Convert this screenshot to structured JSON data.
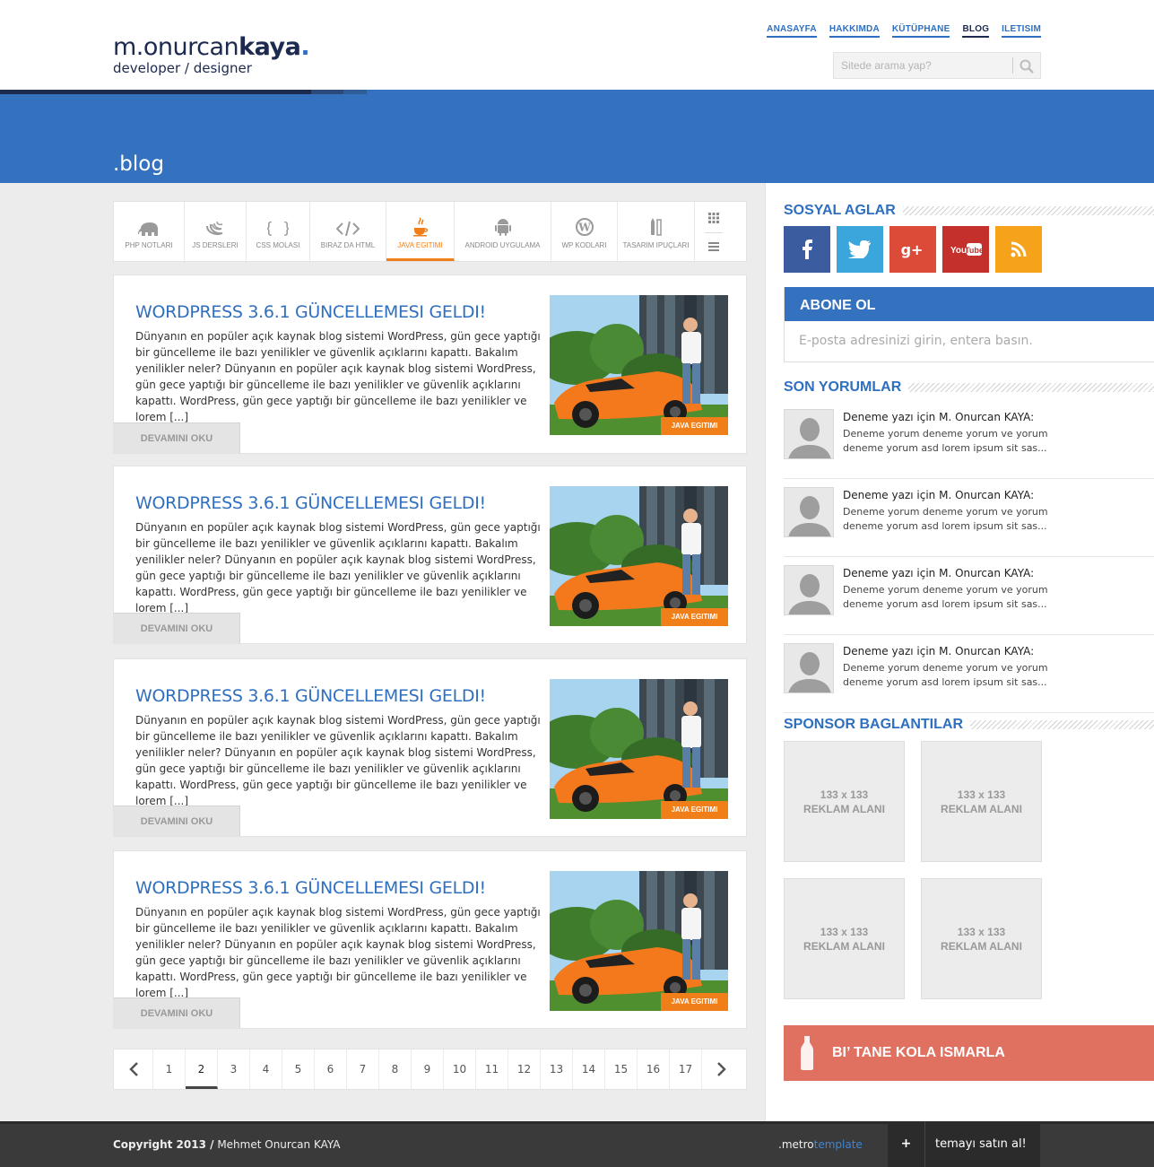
{
  "logo": {
    "name_light": "m.onurcan",
    "name_bold": "kaya",
    "dot": ".",
    "tagline": "developer / designer"
  },
  "nav": [
    {
      "label": "ANASAYFA",
      "active": false
    },
    {
      "label": "HAKKIMDA",
      "active": false
    },
    {
      "label": "KÜTÜPHANE",
      "active": false
    },
    {
      "label": "BLOG",
      "active": true
    },
    {
      "label": "ILETISIM",
      "active": false
    }
  ],
  "search": {
    "placeholder": "Sitede arama yap?"
  },
  "hero": {
    "title": ".blog"
  },
  "categories": [
    {
      "label": "PHP NOTLARI",
      "icon": "php-elephant-icon",
      "active": false
    },
    {
      "label": "JS DERSLERI",
      "icon": "jquery-icon",
      "active": false
    },
    {
      "label": "CSS MOLASI",
      "icon": "curly-braces-icon",
      "active": false
    },
    {
      "label": "BIRAZ DA HTML",
      "icon": "code-tag-icon",
      "active": false
    },
    {
      "label": "JAVA EGITIMI",
      "icon": "java-cup-icon",
      "active": true
    },
    {
      "label": "ANDROID UYGULAMA",
      "icon": "android-icon",
      "active": false
    },
    {
      "label": "WP KODLARI",
      "icon": "wordpress-icon",
      "active": false
    },
    {
      "label": "TASARIM IPUÇLARI",
      "icon": "pencil-icon",
      "active": false
    }
  ],
  "posts": [
    {
      "title": "WORDPRESS 3.6.1 GÜNCELLEMESI GELDI!",
      "excerpt": "Dünyanın en popüler açık kaynak blog sistemi WordPress, gün gece yaptığı bir güncelleme ile bazı yenilikler ve güvenlik açıklarını kapattı. Bakalım yenilikler neler? Dünyanın en popüler açık kaynak blog sistemi WordPress, gün gece yaptığı bir güncelleme ile bazı yenilikler ve güvenlik açıklarını kapattı. WordPress, gün gece yaptığı bir güncelleme ile bazı yenilikler ve lorem [...]",
      "tag": "JAVA EGITIMI",
      "more": "DEVAMINI OKU"
    },
    {
      "title": "WORDPRESS 3.6.1 GÜNCELLEMESI GELDI!",
      "excerpt": "Dünyanın en popüler açık kaynak blog sistemi WordPress, gün gece yaptığı bir güncelleme ile bazı yenilikler ve güvenlik açıklarını kapattı. Bakalım yenilikler neler? Dünyanın en popüler açık kaynak blog sistemi WordPress, gün gece yaptığı bir güncelleme ile bazı yenilikler ve güvenlik açıklarını kapattı. WordPress, gün gece yaptığı bir güncelleme ile bazı yenilikler ve lorem [...]",
      "tag": "JAVA EGITIMI",
      "more": "DEVAMINI OKU"
    },
    {
      "title": "WORDPRESS 3.6.1 GÜNCELLEMESI GELDI!",
      "excerpt": "Dünyanın en popüler açık kaynak blog sistemi WordPress, gün gece yaptığı bir güncelleme ile bazı yenilikler ve güvenlik açıklarını kapattı. Bakalım yenilikler neler? Dünyanın en popüler açık kaynak blog sistemi WordPress, gün gece yaptığı bir güncelleme ile bazı yenilikler ve güvenlik açıklarını kapattı. WordPress, gün gece yaptığı bir güncelleme ile bazı yenilikler ve lorem [...]",
      "tag": "JAVA EGITIMI",
      "more": "DEVAMINI OKU"
    },
    {
      "title": "WORDPRESS 3.6.1 GÜNCELLEMESI GELDI!",
      "excerpt": "Dünyanın en popüler açık kaynak blog sistemi WordPress, gün gece yaptığı bir güncelleme ile bazı yenilikler ve güvenlik açıklarını kapattı. Bakalım yenilikler neler? Dünyanın en popüler açık kaynak blog sistemi WordPress, gün gece yaptığı bir güncelleme ile bazı yenilikler ve güvenlik açıklarını kapattı. WordPress, gün gece yaptığı bir güncelleme ile bazı yenilikler ve lorem [...]",
      "tag": "JAVA EGITIMI",
      "more": "DEVAMINI OKU"
    }
  ],
  "pagination": {
    "pages": [
      "1",
      "2",
      "3",
      "4",
      "5",
      "6",
      "7",
      "8",
      "9",
      "10",
      "11",
      "12",
      "13",
      "14",
      "15",
      "16",
      "17"
    ],
    "current": "2"
  },
  "sidebar": {
    "social_title": "SOSYAL AGLAR",
    "social": [
      {
        "name": "facebook",
        "glyph": "f",
        "color": "#3b5c9e"
      },
      {
        "name": "twitter",
        "glyph": "t",
        "color": "#3aa6dc"
      },
      {
        "name": "google-plus",
        "glyph": "g+",
        "color": "#dc4a38"
      },
      {
        "name": "youtube",
        "glyph": "YouTube",
        "color": "#c4302b"
      },
      {
        "name": "rss",
        "glyph": "rss",
        "color": "#f7a21b"
      }
    ],
    "subscribe_title": "ABONE OL",
    "subscribe_placeholder": "E-posta adresinizi girin, entera basın.",
    "comments_title": "SON YORUMLAR",
    "comments": [
      {
        "title": "Deneme yazı için M. Onurcan KAYA:",
        "body": "Deneme yorum deneme yorum ve yorum deneme yorum asd lorem ipsum sit sas..."
      },
      {
        "title": "Deneme yazı için M. Onurcan KAYA:",
        "body": "Deneme yorum deneme yorum ve yorum deneme yorum asd lorem ipsum sit sas..."
      },
      {
        "title": "Deneme yazı için M. Onurcan KAYA:",
        "body": "Deneme yorum deneme yorum ve yorum deneme yorum asd lorem ipsum sit sas..."
      },
      {
        "title": "Deneme yazı için M. Onurcan KAYA:",
        "body": "Deneme yorum deneme yorum ve yorum deneme yorum asd lorem ipsum sit sas..."
      }
    ],
    "sponsor_title": "SPONSOR BAGLANTILAR",
    "ads": [
      {
        "size": "133 x 133",
        "label": "REKLAM ALANI"
      },
      {
        "size": "133 x 133",
        "label": "REKLAM ALANI"
      },
      {
        "size": "133 x 133",
        "label": "REKLAM ALANI"
      },
      {
        "size": "133 x 133",
        "label": "REKLAM ALANI"
      }
    ],
    "kola": "BI’ TANE KOLA ISMARLA"
  },
  "footer": {
    "copyright_bold": "Copyright 2013 /",
    "copyright_name": " Mehmet Onurcan KAYA",
    "metro_a": ".metro",
    "metro_b": "template",
    "buy_plus": "+",
    "buy_label": "temayı satın al!"
  },
  "colors": {
    "brand_blue": "#3472bf",
    "accent_orange": "#f07f1a",
    "kola": "#e0705f",
    "footer": "#3a3a3a"
  }
}
